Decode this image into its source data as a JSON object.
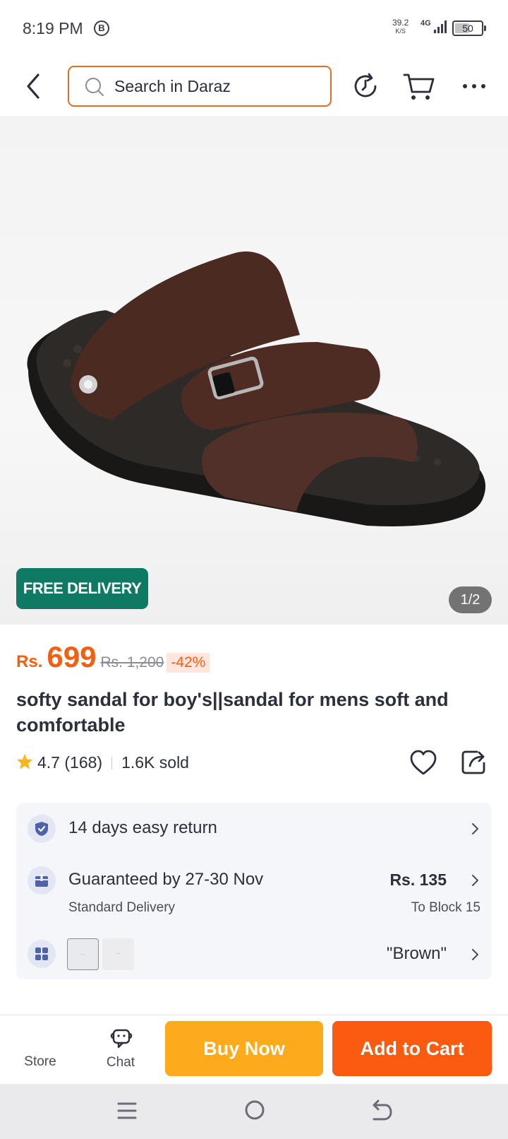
{
  "status_bar": {
    "time": "8:19 PM",
    "b_icon_letter": "B",
    "net_speed": "39.2",
    "net_speed_unit": "K/S",
    "network": "4G",
    "battery": "50"
  },
  "header": {
    "search_placeholder": "Search in Daraz",
    "icons": [
      "back-arrow-icon",
      "search-icon",
      "history-icon",
      "cart-icon",
      "more-icon"
    ]
  },
  "gallery": {
    "badge": "FREE DELIVERY",
    "page_indicator": "1/2",
    "colors": {
      "badge_bg": "#0e7a63",
      "indicator_bg": "#737373"
    }
  },
  "product": {
    "currency": "Rs.",
    "price": "699",
    "original_price": "Rs. 1,200",
    "discount": "-42%",
    "title": "softy sandal for boy's||sandal for mens soft and comfortable",
    "rating": "4.7",
    "review_count": "(168)",
    "sold": "1.6K sold",
    "colors": {
      "price": "#f55f0f",
      "discount_bg": "#ffe6dc"
    }
  },
  "services": {
    "return_text": "14 days easy return",
    "delivery_text": "Guaranteed by 27-30 Nov",
    "delivery_type": "Standard Delivery",
    "shipping_fee": "Rs. 135",
    "ship_to": "To Block 15",
    "variant": "\"Brown\"",
    "swatch_placeholder": "---"
  },
  "actions": {
    "store_label": "Store",
    "chat_label": "Chat",
    "buy_now": "Buy Now",
    "add_to_cart": "Add to Cart",
    "colors": {
      "buy_now": "#fdab1a",
      "add_to_cart": "#fa5b11"
    }
  }
}
